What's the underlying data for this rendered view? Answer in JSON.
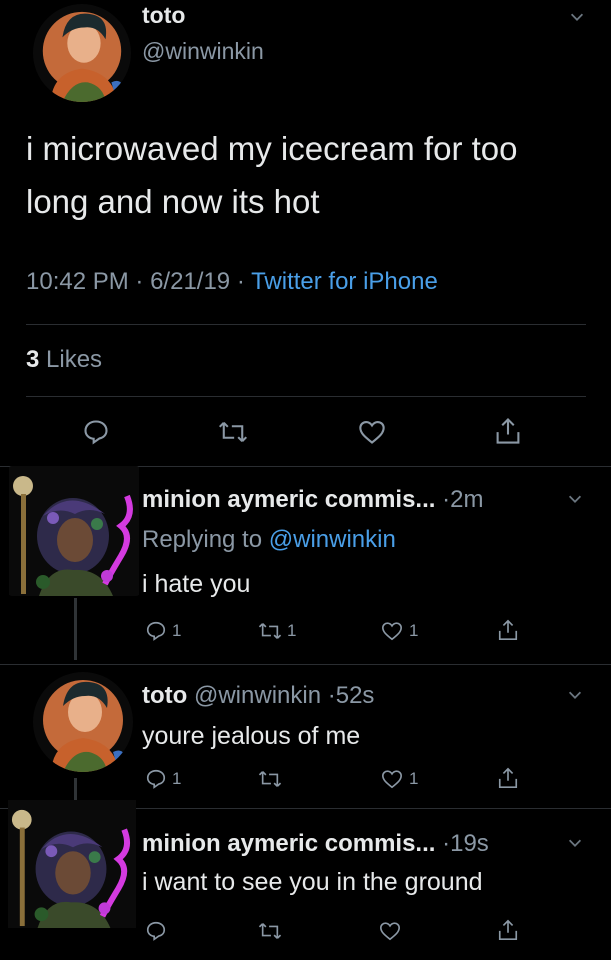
{
  "main_tweet": {
    "display_name": "toto",
    "handle": "@winwinkin",
    "text_line1": "i microwaved my icecream for too",
    "text_line2": "long and now its hot",
    "time": "10:42 PM",
    "sep1": "·",
    "date": "6/21/19",
    "sep2": "·",
    "source": "Twitter for iPhone",
    "likes_count": "3",
    "likes_label": "Likes"
  },
  "reply1": {
    "display_name": "minion aymeric commis...",
    "time": "·2m",
    "replying_prefix": "Replying to",
    "replying_handle": "@winwinkin",
    "text": "i hate you",
    "reply_count": "1",
    "retweet_count": "1",
    "like_count": "1"
  },
  "reply2": {
    "display_name": "toto",
    "handle": "@winwinkin",
    "time": "·52s",
    "text": "youre jealous of me",
    "reply_count": "1",
    "like_count": "1"
  },
  "reply3": {
    "display_name": "minion aymeric commis...",
    "time": "·19s",
    "text": "i want to see you in the ground"
  },
  "icons": [
    "chevron-down-icon",
    "reply-icon",
    "retweet-icon",
    "like-icon",
    "share-icon"
  ],
  "colors": {
    "background": "#000000",
    "link": "#4a9fe8",
    "muted": "#8b98a5",
    "text": "#e7e9ea"
  }
}
